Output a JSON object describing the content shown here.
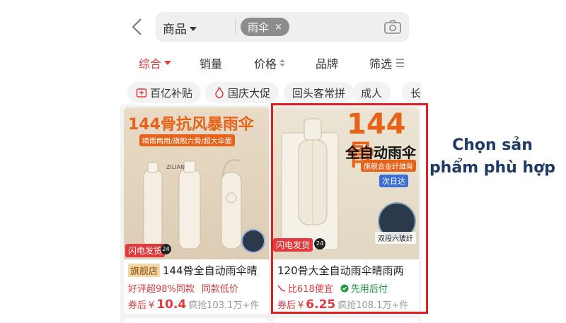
{
  "search": {
    "scope_label": "商品",
    "query_chip": "雨伞",
    "chip_close": "×"
  },
  "sort_tabs": [
    "综合",
    "销量",
    "价格",
    "品牌",
    "筛选"
  ],
  "tags": [
    "百亿补贴",
    "国庆大促",
    "回头客常拼",
    "成人",
    "长"
  ],
  "products": [
    {
      "banner": "144骨抗风暴雨伞",
      "banner_sub": "晴雨两用/旗舰六骨/超大伞面",
      "brand_mark": "ZILIAN",
      "flash_label": "闪电发货",
      "flash_num": "24",
      "flag": "旗舰店",
      "title": "144骨全自动雨伞晴",
      "sub1": "好评超98%同款",
      "sub2": "同款低价",
      "price_prefix": "券后",
      "currency": "¥",
      "price": "10.4",
      "sold": "疯抢103.1万+件"
    },
    {
      "banner_big": "144骨",
      "banner_line2": "全自动雨伞",
      "banner_tag": "旗舰合金纤维骨",
      "banner_tag2": "次日达",
      "fiber_label": "双段六玻纤",
      "flash_label": "闪电发货",
      "flash_num": "24",
      "title": "120骨大全自动雨伞晴雨两",
      "sub1": "比618便宜",
      "sub2": "先用后付",
      "price_prefix": "券后",
      "currency": "¥",
      "price": "6.25",
      "sold": "疯抢108.1万+件"
    }
  ],
  "annotation": "Chọn sản phẩm phù hợp",
  "colors": {
    "accent_red": "#e4393c",
    "highlight_border": "#e02020",
    "note_text": "#1f3a66",
    "banner_orange": "#e8621a"
  }
}
